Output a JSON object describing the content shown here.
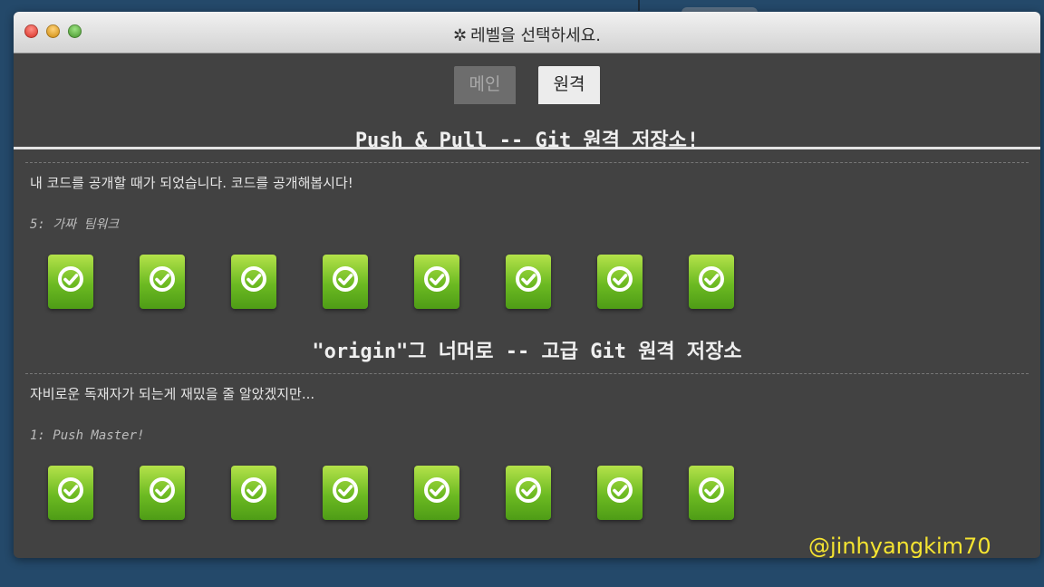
{
  "window": {
    "title": "레벨을 선택하세요.",
    "title_icon": "gear-icon"
  },
  "tabs": [
    {
      "label": "메인",
      "active": false
    },
    {
      "label": "원격",
      "active": true
    }
  ],
  "sections": [
    {
      "title": "Push & Pull -- Git 원격 저장소!",
      "description": "내 코드를 공개할 때가 되었습니다. 코드를 공개해봅시다!",
      "current_level": "5: 가짜 팀워크",
      "levels": [
        {
          "completed": true,
          "icon": "check-circle-icon"
        },
        {
          "completed": true,
          "icon": "check-circle-icon"
        },
        {
          "completed": true,
          "icon": "check-circle-icon"
        },
        {
          "completed": true,
          "icon": "check-circle-icon"
        },
        {
          "completed": true,
          "icon": "check-circle-icon"
        },
        {
          "completed": true,
          "icon": "check-circle-icon"
        },
        {
          "completed": true,
          "icon": "check-circle-icon"
        },
        {
          "completed": true,
          "icon": "check-circle-icon"
        }
      ]
    },
    {
      "title": "\"origin\"그 너머로 -- 고급 Git 원격 저장소",
      "description": "자비로운 독재자가 되는게 재밌을 줄 알았겠지만...",
      "current_level": "1: Push Master!",
      "levels": [
        {
          "completed": true,
          "icon": "check-circle-icon"
        },
        {
          "completed": true,
          "icon": "check-circle-icon"
        },
        {
          "completed": true,
          "icon": "check-circle-icon"
        },
        {
          "completed": true,
          "icon": "check-circle-icon"
        },
        {
          "completed": true,
          "icon": "check-circle-icon"
        },
        {
          "completed": true,
          "icon": "check-circle-icon"
        },
        {
          "completed": true,
          "icon": "check-circle-icon"
        },
        {
          "completed": true,
          "icon": "check-circle-icon"
        }
      ]
    }
  ],
  "watermark": "@jinhyangkim70",
  "colors": {
    "desktop": "#24496a",
    "window_bg": "#424242",
    "level_green": "#6cba22",
    "watermark": "#f5e431"
  }
}
